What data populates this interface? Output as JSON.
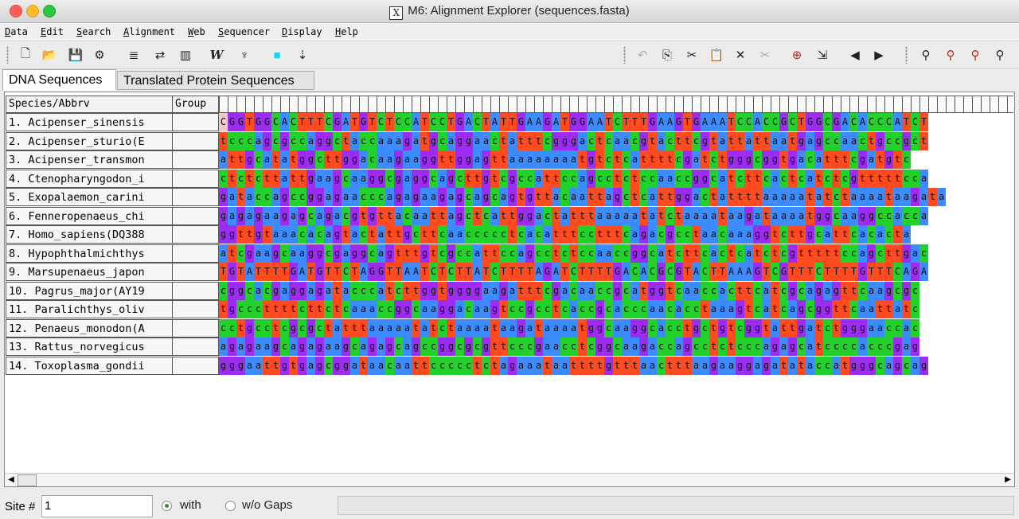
{
  "window": {
    "title": "M6: Alignment Explorer (sequences.fasta)"
  },
  "menu": [
    "Data",
    "Edit",
    "Search",
    "Alignment",
    "Web",
    "Sequencer",
    "Display",
    "Help"
  ],
  "toolbar": {
    "left": [
      "new-icon",
      "open-icon",
      "save-icon",
      "codon-icon",
      "align-clustal-icon",
      "translate-icon",
      "sequencer-icon",
      "wordset-icon",
      "muscle-icon",
      "color-icon",
      "trim-icon"
    ],
    "right": [
      "undo-icon",
      "copy-icon",
      "cut-icon",
      "paste-icon",
      "delete-icon",
      "delete-gap-icon",
      "add-sequence-icon",
      "import-icon",
      "prev-icon",
      "next-icon",
      "find-icon",
      "find-prev-icon",
      "find-next-icon",
      "find-motif-icon"
    ]
  },
  "tabs": [
    {
      "label": "DNA Sequences",
      "active": true
    },
    {
      "label": "Translated Protein Sequences",
      "active": false
    }
  ],
  "grid": {
    "header_species": "Species/Abbrv",
    "header_group": "Group",
    "colors": {
      "A": "#3c8cff",
      "T": "#ff4b1f",
      "G": "#9d2cf2",
      "C": "#22d22a"
    },
    "rows": [
      {
        "name": "1. Acipenser_sinensis",
        "seq": "CGGTGGCACTTTCGATGTCTCCATCCTGACTATTGAAGATGGAATCTTTGAAGTGAAATCCACCGCTGGCGACACCCATCT"
      },
      {
        "name": "2. Acipenser_sturio(E",
        "seq": "tcccagcgccaggctaccaaagatgcaggaactatttcgggactcaacgtacttcgtattattaatgagccaactgccgct"
      },
      {
        "name": "3. Acipenser_transmon",
        "seq": "attgcatatggcttggacaagaaggttggagttaaaaaaaatgtctcattttcgatctgggcggtgacatttcgatgtc"
      },
      {
        "name": "4. Ctenopharyngodon_i",
        "seq": "ctctcttattgaagcaaggcgaggcagcttgtcgccattccagcctctccaaccggcatcttcactcatctcgtttttcca"
      },
      {
        "name": "5. Exopalaemon_carini",
        "seq": "gataccagccggagaacccagagaagagcagcagtgttacaattagctcattggactattttaaaaatatctaaaataagata"
      },
      {
        "name": "6. Fenneropenaeus_chi",
        "seq": "gagagaagagcagacgtgttacaattagctcattggactatttaaaaatatctaaaataagataaaatggcaaggccacca"
      },
      {
        "name": "7. Homo_sapiens(DQ388",
        "seq": "ggttgtaaacacagtactattgcttcaaccccctcacatttcctttcagacgcctaacaaaggtcttgcattcacacta"
      },
      {
        "name": "8. Hypophthalmichthys",
        "seq": "atcgaagcaaggcgaggcagtttgtcgccattccagcctctccaaccggcatcttcactcatctcgtttttccagcttgac"
      },
      {
        "name": "9. Marsupenaeus_japon",
        "seq": "TGTATTTTGATGTTCTAGGTTAATCTCTTATCTTTTAGATCTTTTGACACGCGTACTTAAAGTCGTTTCTTTTGTTTCAGA"
      },
      {
        "name": "10. Pagrus_major(AY19",
        "seq": "cggcacgaggagatacccatcttggtggggaagatttcgacaaccgcatggtcaaccacttcatcgcagagttcaagcgc"
      },
      {
        "name": "11. Paralichthys_oliv",
        "seq": "tgcccttttcttctcaaaccggcaaggacaagtccgcctcaccgcacccaacacctaaagtcatcagcggttcaattatc"
      },
      {
        "name": "12. Penaeus_monodon(A",
        "seq": "cctgcctcgcgctatttaaaaatatctaaaataagataaaatggcaaggcacctgctgtcggtattgatctgggaaccac"
      },
      {
        "name": "13. Rattus_norvegicus",
        "seq": "agagaagcagagaagcagagcagccggcgcgttcccgaacctcggcaagaccagcctctcccagagcatccccacccgag"
      },
      {
        "name": "14. Toxoplasma_gondii",
        "seq": "gggaattgtgagcggataacaattccccctctagaaataattttgtttaactttaagaaggagatataccatgggcagcag"
      }
    ]
  },
  "status": {
    "site_label": "Site #",
    "site_value": "1",
    "with_label": "with",
    "without_label": "w/o Gaps",
    "with_selected": true
  }
}
